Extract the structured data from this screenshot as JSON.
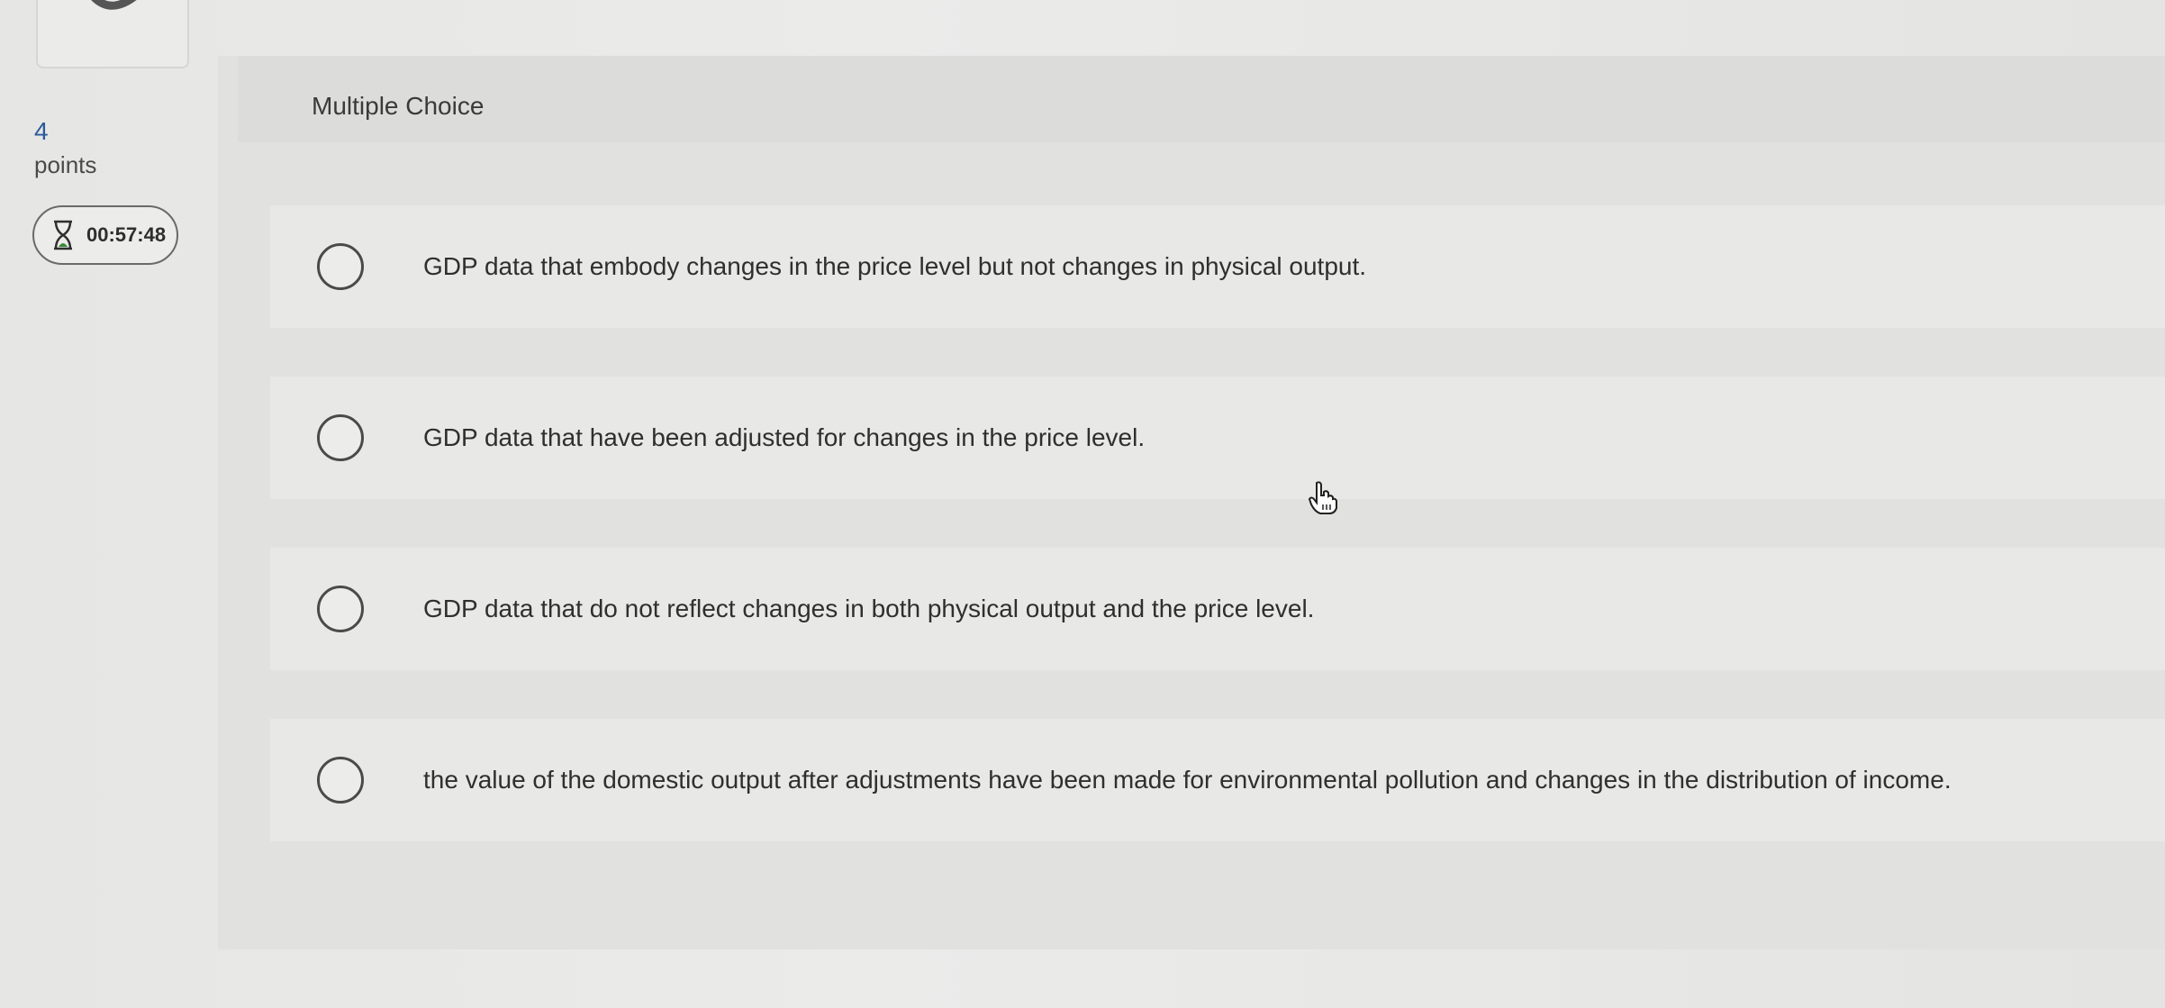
{
  "sidebar": {
    "points_value": "4",
    "points_label": "points",
    "timer": "00:57:48"
  },
  "question": {
    "type_label": "Multiple Choice",
    "options": [
      {
        "text": "GDP data that embody changes in the price level but not changes in physical output."
      },
      {
        "text": "GDP data that have been adjusted for changes in the price level."
      },
      {
        "text": "GDP data that do not reflect changes in both physical output and the price level."
      },
      {
        "text": "the value of the domestic output after adjustments have been made for environmental pollution and changes in the distribution of income."
      }
    ]
  },
  "icons": {
    "timer": "hourglass-icon",
    "cursor": "hand-pointer-icon"
  },
  "colors": {
    "points_number": "#2b5a9a",
    "hourglass": "#3a8a3a"
  }
}
